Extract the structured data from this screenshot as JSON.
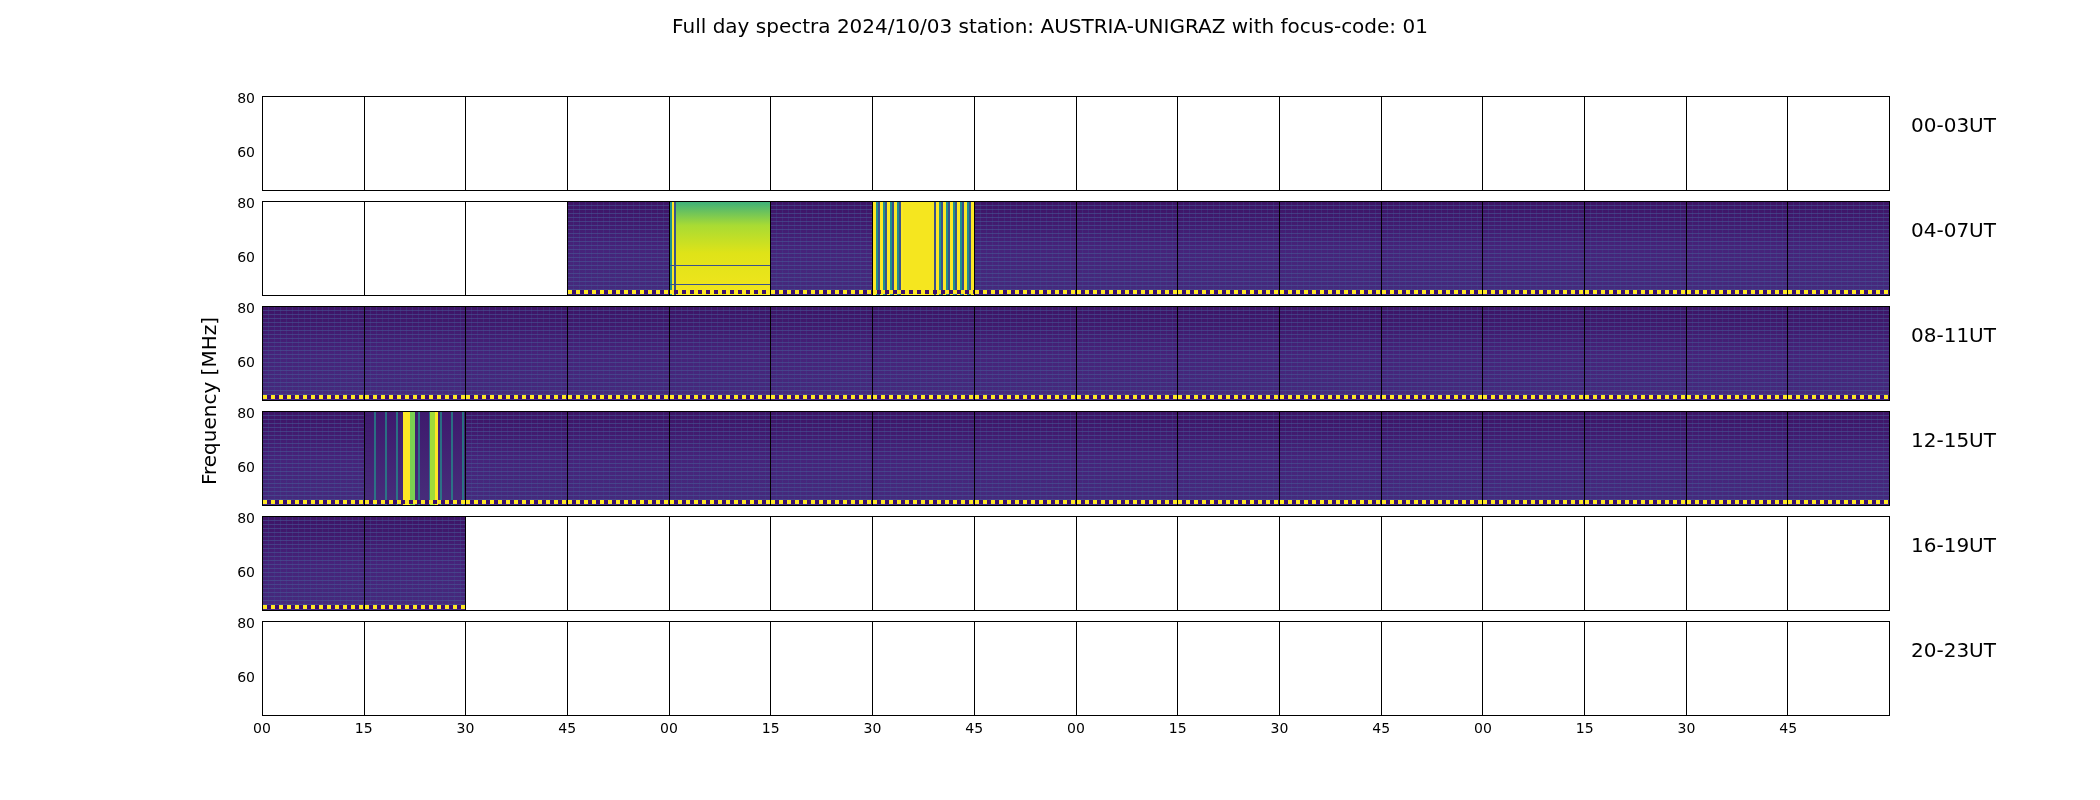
{
  "title": "Full day spectra 2024/10/03 station: AUSTRIA-UNIGRAZ with focus-code: 01",
  "ylabel": "Frequency [MHz]",
  "rows": [
    {
      "label": "00-03UT",
      "yticks": [
        "80",
        "60"
      ],
      "panels": [
        {
          "kind": "blank"
        },
        {
          "kind": "blank"
        },
        {
          "kind": "blank"
        },
        {
          "kind": "blank"
        },
        {
          "kind": "blank"
        },
        {
          "kind": "blank"
        },
        {
          "kind": "blank"
        },
        {
          "kind": "blank"
        },
        {
          "kind": "blank"
        },
        {
          "kind": "blank"
        },
        {
          "kind": "blank"
        },
        {
          "kind": "blank"
        },
        {
          "kind": "blank"
        },
        {
          "kind": "blank"
        },
        {
          "kind": "blank"
        },
        {
          "kind": "blank"
        }
      ]
    },
    {
      "label": "04-07UT",
      "yticks": [
        "80",
        "60"
      ],
      "panels": [
        {
          "kind": "blank"
        },
        {
          "kind": "blank"
        },
        {
          "kind": "blank"
        },
        {
          "kind": "quiet"
        },
        {
          "kind": "saturated"
        },
        {
          "kind": "quiet"
        },
        {
          "kind": "striped"
        },
        {
          "kind": "quiet"
        },
        {
          "kind": "quiet"
        },
        {
          "kind": "quiet"
        },
        {
          "kind": "quiet"
        },
        {
          "kind": "quiet"
        },
        {
          "kind": "quiet"
        },
        {
          "kind": "quiet"
        },
        {
          "kind": "quiet"
        },
        {
          "kind": "quiet"
        }
      ]
    },
    {
      "label": "08-11UT",
      "yticks": [
        "80",
        "60"
      ],
      "panels": [
        {
          "kind": "quiet"
        },
        {
          "kind": "quiet"
        },
        {
          "kind": "quiet"
        },
        {
          "kind": "quiet"
        },
        {
          "kind": "quiet"
        },
        {
          "kind": "quiet"
        },
        {
          "kind": "quiet"
        },
        {
          "kind": "quiet"
        },
        {
          "kind": "quiet"
        },
        {
          "kind": "quiet"
        },
        {
          "kind": "quiet"
        },
        {
          "kind": "quiet"
        },
        {
          "kind": "quiet"
        },
        {
          "kind": "quiet"
        },
        {
          "kind": "quiet"
        },
        {
          "kind": "quiet"
        }
      ]
    },
    {
      "label": "12-15UT",
      "yticks": [
        "80",
        "60"
      ],
      "panels": [
        {
          "kind": "quiet"
        },
        {
          "kind": "burst"
        },
        {
          "kind": "quiet"
        },
        {
          "kind": "quiet"
        },
        {
          "kind": "quiet"
        },
        {
          "kind": "quiet"
        },
        {
          "kind": "quiet"
        },
        {
          "kind": "quiet"
        },
        {
          "kind": "quiet"
        },
        {
          "kind": "quiet"
        },
        {
          "kind": "quiet"
        },
        {
          "kind": "quiet"
        },
        {
          "kind": "quiet"
        },
        {
          "kind": "quiet"
        },
        {
          "kind": "quiet"
        },
        {
          "kind": "quiet"
        }
      ]
    },
    {
      "label": "16-19UT",
      "yticks": [
        "80",
        "60"
      ],
      "panels": [
        {
          "kind": "quiet"
        },
        {
          "kind": "quiet"
        },
        {
          "kind": "blank"
        },
        {
          "kind": "blank"
        },
        {
          "kind": "blank"
        },
        {
          "kind": "blank"
        },
        {
          "kind": "blank"
        },
        {
          "kind": "blank"
        },
        {
          "kind": "blank"
        },
        {
          "kind": "blank"
        },
        {
          "kind": "blank"
        },
        {
          "kind": "blank"
        },
        {
          "kind": "blank"
        },
        {
          "kind": "blank"
        },
        {
          "kind": "blank"
        },
        {
          "kind": "blank"
        }
      ]
    },
    {
      "label": "20-23UT",
      "yticks": [
        "80",
        "60"
      ],
      "panels": [
        {
          "kind": "blank"
        },
        {
          "kind": "blank"
        },
        {
          "kind": "blank"
        },
        {
          "kind": "blank"
        },
        {
          "kind": "blank"
        },
        {
          "kind": "blank"
        },
        {
          "kind": "blank"
        },
        {
          "kind": "blank"
        },
        {
          "kind": "blank"
        },
        {
          "kind": "blank"
        },
        {
          "kind": "blank"
        },
        {
          "kind": "blank"
        },
        {
          "kind": "blank"
        },
        {
          "kind": "blank"
        },
        {
          "kind": "blank"
        },
        {
          "kind": "blank"
        }
      ]
    }
  ],
  "xticks": [
    "00",
    "15",
    "30",
    "45",
    "00",
    "15",
    "30",
    "45",
    "00",
    "15",
    "30",
    "45",
    "00",
    "15",
    "30",
    "45"
  ]
}
